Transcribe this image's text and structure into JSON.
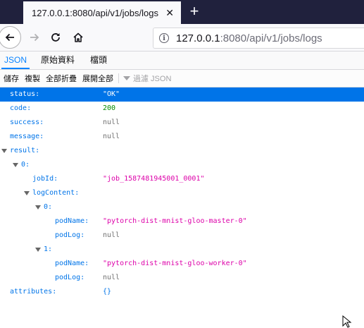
{
  "browser": {
    "tab_title": "127.0.0.1:8080/api/v1/jobs/logs",
    "url_host": "127.0.0.1",
    "url_rest": ":8080/api/v1/jobs/logs"
  },
  "viewer": {
    "tabs": [
      "JSON",
      "原始資料",
      "檔頭"
    ],
    "toolbar": {
      "save": "儲存",
      "copy": "複製",
      "collapse_all": "全部折疊",
      "expand_all": "展開全部",
      "filter_placeholder": "過濾 JSON"
    }
  },
  "json": {
    "status": {
      "key": "status:",
      "value": "\"OK\""
    },
    "code": {
      "key": "code:",
      "value": "200"
    },
    "success": {
      "key": "success:",
      "value": "null"
    },
    "message": {
      "key": "message:",
      "value": "null"
    },
    "result": {
      "key": "result:"
    },
    "item0": {
      "key": "0:"
    },
    "jobId": {
      "key": "jobId:",
      "value": "\"job_1587481945001_0001\""
    },
    "logContent": {
      "key": "logContent:"
    },
    "log0": {
      "key": "0:",
      "podName_key": "podName:",
      "podName": "\"pytorch-dist-mnist-gloo-master-0\"",
      "podLog_key": "podLog:",
      "podLog": "null"
    },
    "log1": {
      "key": "1:",
      "podName_key": "podName:",
      "podName": "\"pytorch-dist-mnist-gloo-worker-0\"",
      "podLog_key": "podLog:",
      "podLog": "null"
    },
    "attributes": {
      "key": "attributes:",
      "value": "{}"
    }
  },
  "colors": {
    "accent": "#0074e8",
    "string": "#dd00a9",
    "number": "#058b00",
    "null": "#737373",
    "tabstrip": "#20213d"
  }
}
